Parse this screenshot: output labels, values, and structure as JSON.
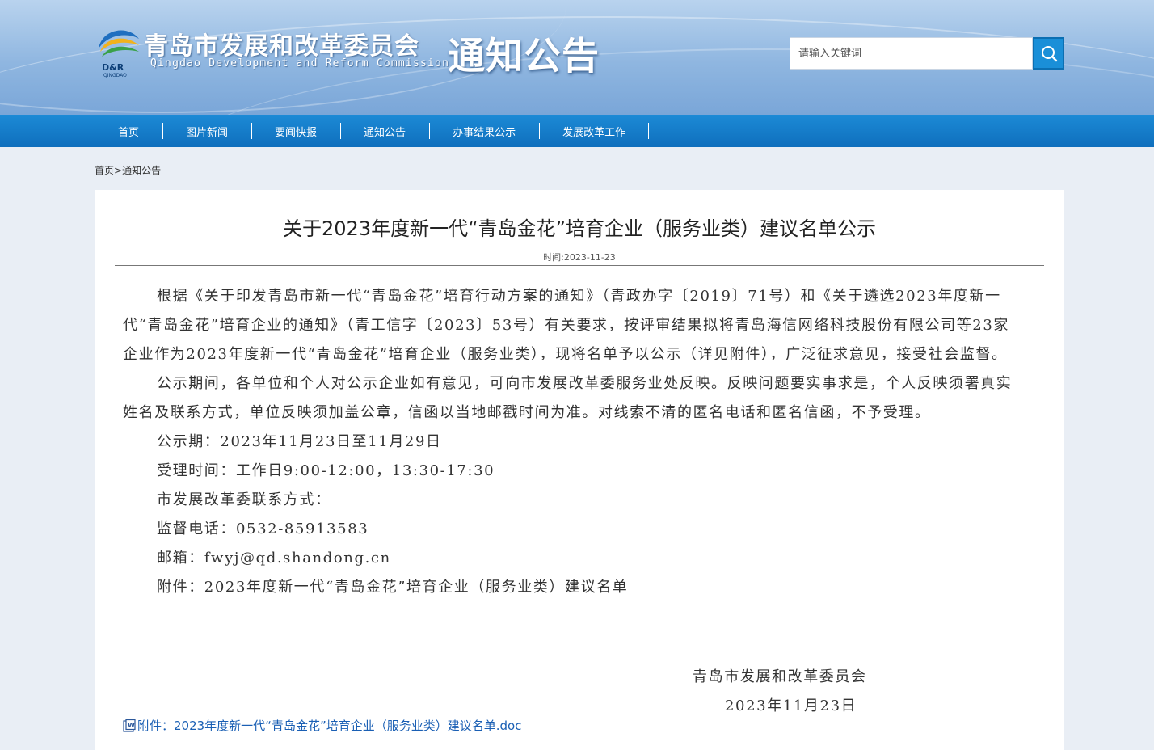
{
  "header": {
    "logo_abbr": "D&R",
    "logo_city": "QINGDAO",
    "org_name_cn": "青岛市发展和改革委员会",
    "org_name_en": "Qingdao Development and Reform Commission",
    "section_title": "通知公告"
  },
  "search": {
    "placeholder": "请输入关键词",
    "icon": "search-icon"
  },
  "nav": {
    "items": [
      "首页",
      "图片新闻",
      "要闻快报",
      "通知公告",
      "办事结果公示",
      "发展改革工作"
    ]
  },
  "breadcrumb": {
    "home": "首页",
    "separator": ">",
    "current": "通知公告"
  },
  "article": {
    "title": "关于2023年度新一代“青岛金花”培育企业（服务业类）建议名单公示",
    "time_label": "时间:2023-11-23",
    "paragraphs": [
      "根据《关于印发青岛市新一代“青岛金花”培育行动方案的通知》（青政办字〔2019〕71号）和《关于遴选2023年度新一代“青岛金花”培育企业的通知》（青工信字〔2023〕53号）有关要求，按评审结果拟将青岛海信网络科技股份有限公司等23家企业作为2023年度新一代“青岛金花”培育企业（服务业类），现将名单予以公示（详见附件），广泛征求意见，接受社会监督。",
      "公示期间，各单位和个人对公示企业如有意见，可向市发展改革委服务业处反映。反映问题要实事求是，个人反映须署真实姓名及联系方式，单位反映须加盖公章，信函以当地邮戳时间为准。对线索不清的匿名电话和匿名信函，不予受理。"
    ],
    "lines": [
      "公示期：2023年11月23日至11月29日",
      "受理时间：工作日9:00-12:00，13:30-17:30",
      "市发展改革委联系方式：",
      "监督电话：0532-85913583",
      "邮箱：fwyj@qd.shandong.cn",
      "附件：2023年度新一代“青岛金花”培育企业（服务业类）建议名单"
    ],
    "sign_org": "青岛市发展和改革委员会",
    "sign_date": "2023年11月23日",
    "attachment_link": "附件：2023年度新一代“青岛金花”培育企业（服务业类）建议名单.doc"
  },
  "colors": {
    "header_bg": "#8fb6e0",
    "nav_bg": "#1477c8",
    "search_btn": "#1a8fd8",
    "link": "#1a5fb4"
  }
}
